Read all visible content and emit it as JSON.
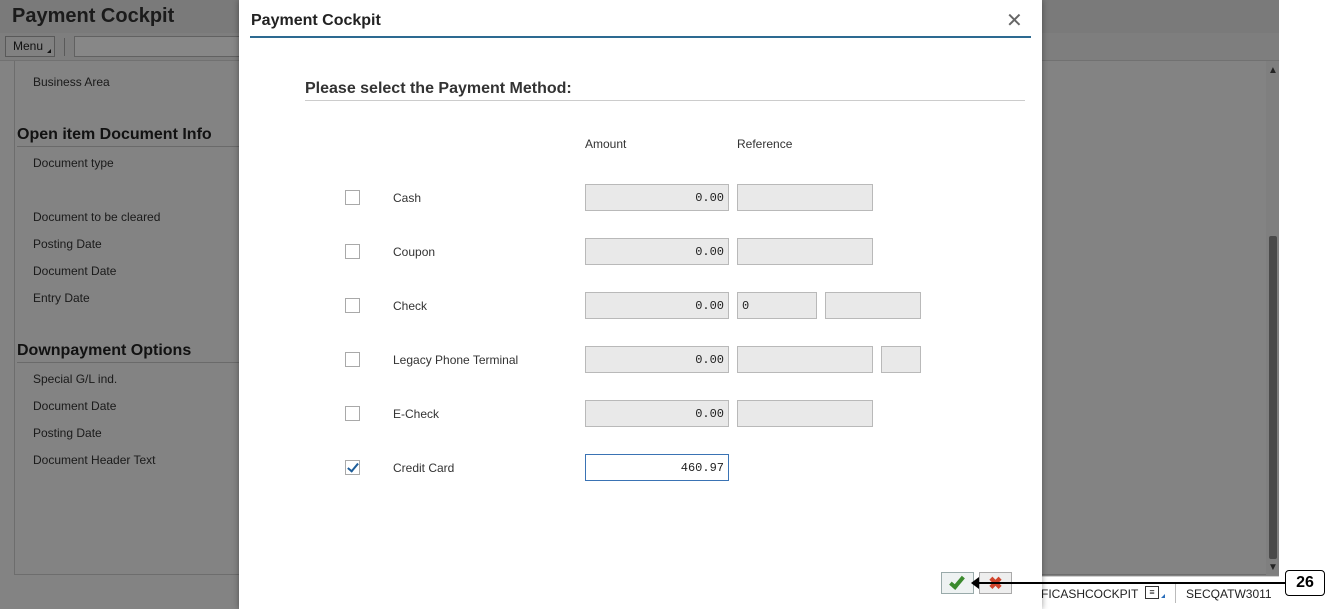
{
  "background": {
    "title": "Payment Cockpit",
    "menu_label": "Menu",
    "fields_top": [
      "Business Area"
    ],
    "section_open_item": {
      "heading": "Open item Document Info",
      "fields": [
        "Document type",
        "Document to be cleared",
        "Posting Date",
        "Document Date",
        "Entry Date"
      ]
    },
    "section_downpayment": {
      "heading": "Downpayment Options",
      "fields": [
        "Special G/L ind.",
        "Document Date",
        "Posting Date",
        "Document Header Text"
      ]
    },
    "status": {
      "transaction": "FICASHCOCKPIT",
      "system": "SECQATW3011"
    }
  },
  "dialog": {
    "title": "Payment Cockpit",
    "close_symbol": "✕",
    "heading": "Please select the Payment Method:",
    "col_amount": "Amount",
    "col_reference": "Reference",
    "rows": [
      {
        "label": "Cash",
        "checked": false,
        "amount": "0.00",
        "reference": ""
      },
      {
        "label": "Coupon",
        "checked": false,
        "amount": "0.00",
        "reference": ""
      },
      {
        "label": "Check",
        "checked": false,
        "amount": "0.00",
        "reference": "0",
        "reference2": ""
      },
      {
        "label": "Legacy Phone Terminal",
        "checked": false,
        "amount": "0.00",
        "reference": "",
        "reference2": ""
      },
      {
        "label": "E-Check",
        "checked": false,
        "amount": "0.00",
        "reference": ""
      },
      {
        "label": "Credit Card",
        "checked": true,
        "amount": "460.97"
      }
    ],
    "cancel_symbol": "✖"
  },
  "annotation": {
    "number": "26"
  },
  "colors": {
    "title_underline": "#2d6a91",
    "ok_green": "#3b8a2e",
    "cancel_red": "#d0442c",
    "active_border": "#3a73b4"
  }
}
